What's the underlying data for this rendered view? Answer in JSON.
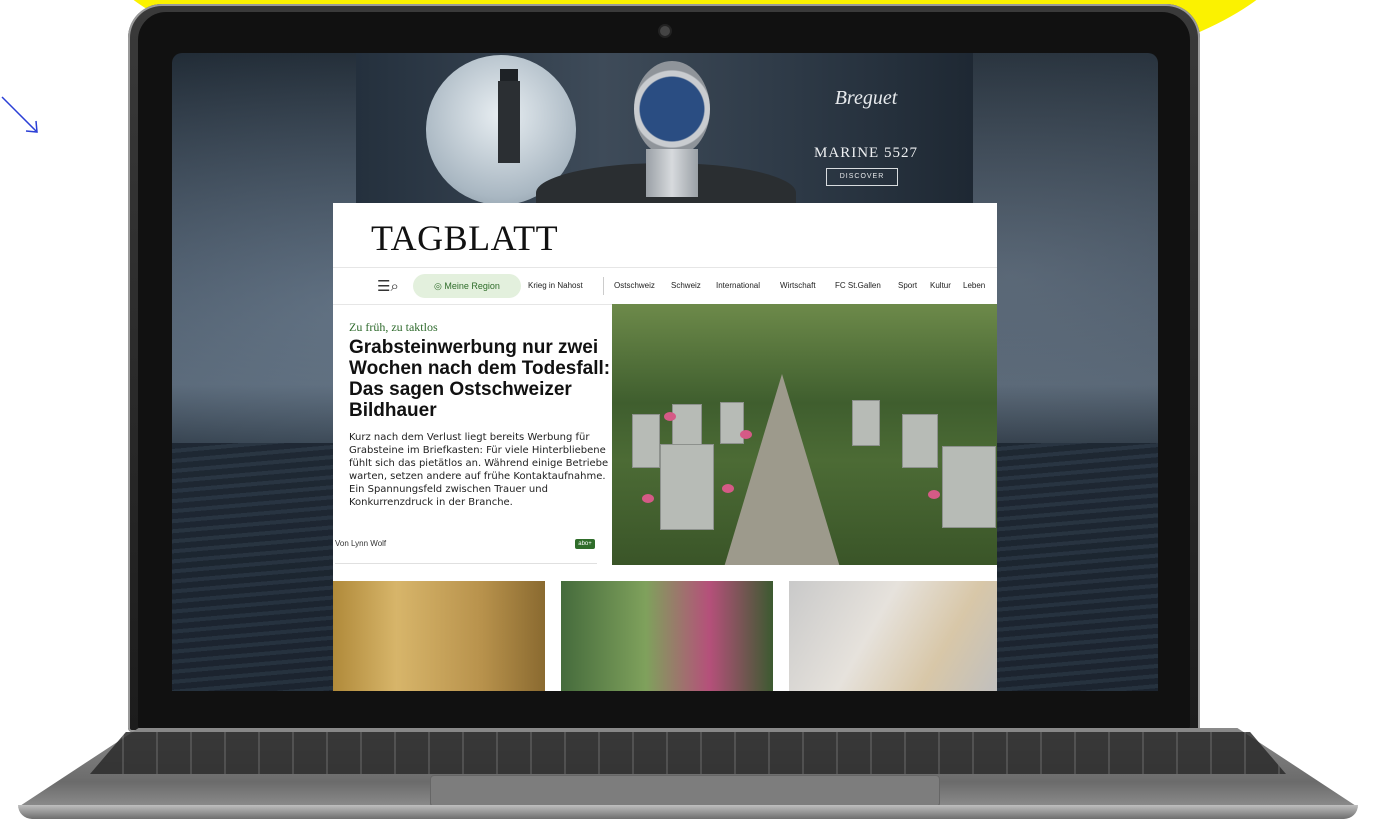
{
  "ad": {
    "brand": "Breguet",
    "model": "MARINE 5527",
    "cta": "DISCOVER"
  },
  "site": {
    "logo": "TAGBLATT"
  },
  "nav": {
    "region": "Meine Region",
    "items": [
      "Krieg in Nahost",
      "Ostschweiz",
      "Schweiz",
      "International",
      "Wirtschaft",
      "FC St.Gallen",
      "Sport",
      "Kultur",
      "Leben"
    ]
  },
  "article": {
    "kicker": "Zu früh, zu taktlos",
    "headline": "Grabsteinwerbung nur zwei Wochen nach dem Todesfall: Das sagen Ostschweizer Bildhauer",
    "lead": "Kurz nach dem Verlust liegt bereits Werbung für Grabsteine im Briefkasten: Für viele Hinterbliebene fühlt sich das pietätlos an. Während einige Betriebe warten, setzen andere auf frühe Kontaktaufnahme. Ein Spannungsfeld zwischen Trauer und Konkurrenzdruck in der Branche.",
    "author": "Von Lynn Wolf",
    "badge": "abo+"
  },
  "colors": {
    "accent_green": "#2f6d2a",
    "background_yellow": "#fbf200"
  }
}
